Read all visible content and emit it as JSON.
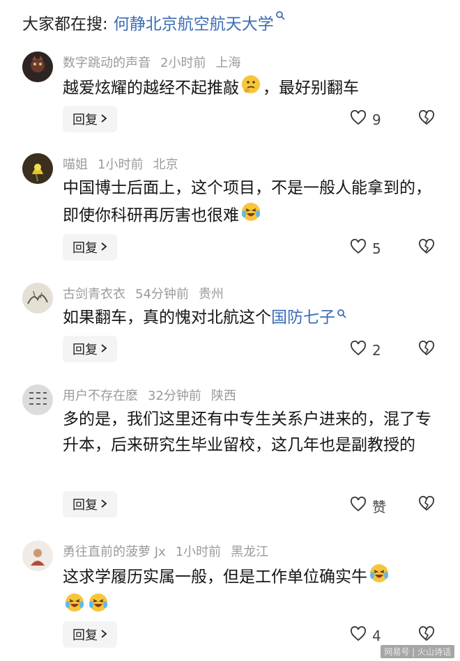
{
  "search": {
    "prefix": "大家都在搜:",
    "query": "何静北京航空航天大学",
    "icon": "search-icon"
  },
  "comments": [
    {
      "user": "数字跳动的声音",
      "time": "2小时前",
      "location": "上海",
      "text": "越爱炫耀的越经不起推敲",
      "text_after": "，最好别翻车",
      "emoji": "thinking-emoji",
      "reply": "回复",
      "likes": "9"
    },
    {
      "user": "喵姐",
      "time": "1小时前",
      "location": "北京",
      "text": "中国博士后面上，这个项目，不是一般人能拿到的，即使你科研再厉害也很难",
      "emoji": "laughing-crying-emoji",
      "reply": "回复",
      "likes": "5"
    },
    {
      "user": "古剑青衣衣",
      "time": "54分钟前",
      "location": "贵州",
      "text": "如果翻车，真的愧对北航这个",
      "link": "国防七子",
      "reply": "回复",
      "likes": "2"
    },
    {
      "user": "用户不存在麽",
      "time": "32分钟前",
      "location": "陕西",
      "text": "多的是，我们这里还有中专生关系户进来的，混了专升本，后来研究生毕业留校，这几年也是副教授的",
      "reply": "回复",
      "likes": "赞"
    },
    {
      "user": "勇往直前的菠萝 Jx",
      "time": "1小时前",
      "location": "黑龙江",
      "text": "这求学履历实属一般，但是工作单位确实牛",
      "emoji": "laughing-crying-emoji",
      "reply": "回复",
      "likes": "4"
    }
  ],
  "watermark": "网易号 | 火山诗话",
  "colors": {
    "link": "#3b6db3",
    "meta": "#9a9a9a",
    "reply_bg": "#f4f4f4"
  }
}
